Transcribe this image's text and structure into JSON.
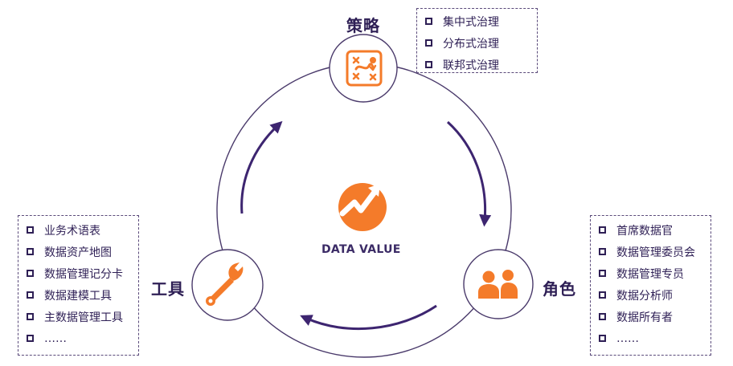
{
  "center": {
    "label": "DATA VALUE"
  },
  "nodes": {
    "strategy": {
      "title": "策略",
      "items": [
        "集中式治理",
        "分布式治理",
        "联邦式治理"
      ]
    },
    "tools": {
      "title": "工具",
      "items": [
        "业务术语表",
        "数据资产地图",
        "数据管理记分卡",
        "数据建模工具",
        "主数据管理工具",
        "……"
      ]
    },
    "roles": {
      "title": "角色",
      "items": [
        "首席数据官",
        "数据管理委员会",
        "数据管理专员",
        "数据分析师",
        "数据所有者",
        "……"
      ]
    }
  },
  "colors": {
    "accent": "#f47b2a",
    "ring": "#4a3a6b",
    "arrow": "#3d2570",
    "text": "#2e1f55"
  },
  "icons": {
    "strategy": "strategy-board-icon",
    "tools": "wrench-icon",
    "roles": "people-icon",
    "center": "growth-arrow-icon"
  }
}
